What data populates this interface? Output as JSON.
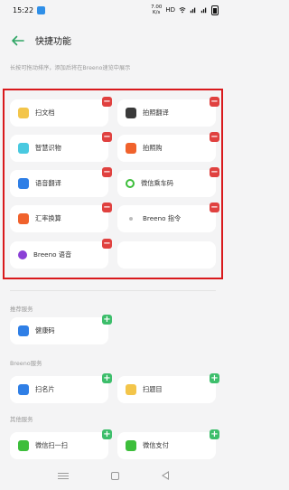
{
  "status_bar": {
    "time": "15:22",
    "speed_value": "7.00",
    "speed_unit": "K/s",
    "network": "HD"
  },
  "header": {
    "title": "快捷功能"
  },
  "hint_text": "长按可拖动排序，添加后将在Breeno速览中展示",
  "enabled": [
    {
      "label": "扫文档",
      "icon": "document-scan-icon",
      "color": "#f3c54a"
    },
    {
      "label": "拍照翻译",
      "icon": "camera-translate-icon",
      "color": "#3a3a3a"
    },
    {
      "label": "智慧识物",
      "icon": "smart-recognition-icon",
      "color": "#49c9e0"
    },
    {
      "label": "拍照购",
      "icon": "photo-shopping-icon",
      "color": "#f0622c"
    },
    {
      "label": "语音翻译",
      "icon": "voice-translate-icon",
      "color": "#2f7fe6"
    },
    {
      "label": "微信乘车码",
      "icon": "wechat-transit-icon",
      "color": "#3dbe3b"
    },
    {
      "label": "汇率换算",
      "icon": "exchange-rate-icon",
      "color": "#f0622c"
    },
    {
      "label": "Breeno 指令",
      "icon": "breeno-command-icon",
      "color": "#bdbdbd"
    },
    {
      "label": "Breeno 语音",
      "icon": "breeno-voice-icon",
      "color": "#8a3fd6"
    }
  ],
  "sections": [
    {
      "title": "推荐服务",
      "items": [
        {
          "label": "健康码",
          "icon": "health-code-icon",
          "color": "#2f7fe6"
        }
      ]
    },
    {
      "title": "Breeno服务",
      "items": [
        {
          "label": "扫名片",
          "icon": "business-card-icon",
          "color": "#2f7fe6"
        },
        {
          "label": "扫题目",
          "icon": "question-scan-icon",
          "color": "#f3c54a"
        }
      ]
    },
    {
      "title": "其他服务",
      "items": [
        {
          "label": "微信扫一扫",
          "icon": "wechat-scan-icon",
          "color": "#3dbe3b"
        },
        {
          "label": "微信支付",
          "icon": "wechat-pay-icon",
          "color": "#3dbe3b"
        }
      ]
    }
  ]
}
